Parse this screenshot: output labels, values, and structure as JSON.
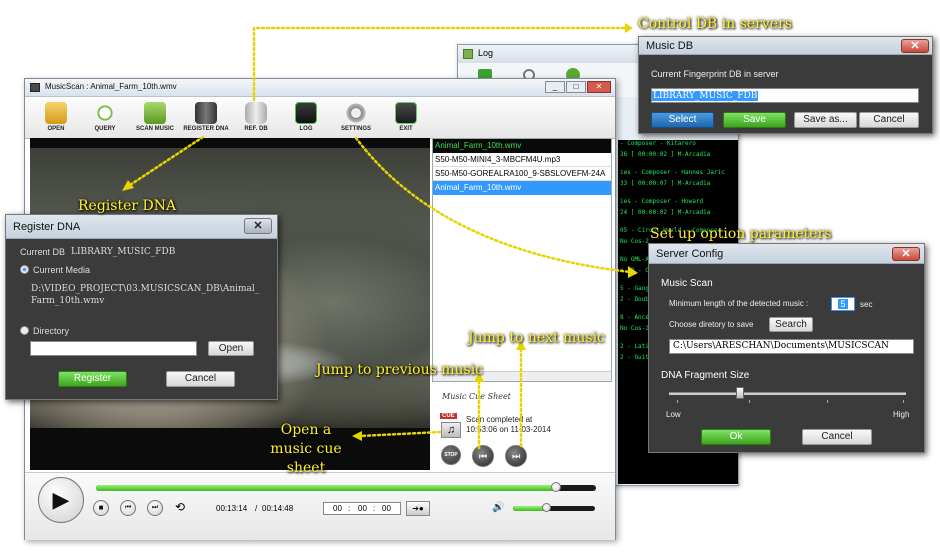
{
  "callouts": {
    "control_db": "Control DB in servers",
    "register_dna": "Register DNA",
    "setup_options": "Set up option parameters",
    "jump_next": "Jump to next music",
    "jump_prev": "Jump to previous music",
    "open_cue": "Open a music cue sheet"
  },
  "log_window": {
    "title": "Log",
    "lines": [
      "- Composer - Kitarero",
      "36 [ 00:00:02 ] M-Arcadia",
      "ies - Composer - Hannes Jaric",
      "33 [ 00:00:07 ] M-Arcadia",
      "ies - Composer - Howard",
      "24 [ 00:00:02 ] M-Arcadia",
      "05 - Circus World - Composer",
      "No Cos-2",
      "No GML-A1",
      "x 22 - Cor",
      "5 - Gang",
      "2 - Doub",
      "8 - Ancé",
      "No Cos-2",
      "2 - Lati",
      "2 - Guitar Sky - Composer -"
    ]
  },
  "main_window": {
    "title": "MusicScan : Animal_Farm_10th.wmv",
    "toolbar": [
      "OPEN",
      "QUERY",
      "SCAN MUSIC",
      "REGISTER DNA",
      "REF. DB",
      "LOG",
      "SETTINGS",
      "EXIT"
    ],
    "playlist": [
      "Animal_Farm_10th.wmv",
      "S50-M50-MINI4_3-MBCFM4U.mp3",
      "S50-M50-GOREALRA100_9-SBSLOVEFM-24A",
      "Animal_Farm_10th.wmv"
    ],
    "cue_sheet_label": "Music Cue Sheet",
    "cue_badge": "CUE",
    "status_line1": "Scan completed at",
    "status_line2": "10:53:06 on 11-03-2014",
    "stop_label": "STOP",
    "time_current": "00:13:14",
    "time_sep": "/",
    "time_total": "00:14:48",
    "seek_h": "00",
    "seek_m": "00",
    "seek_s": "00",
    "progress_pct": 92,
    "volume_pct": 40
  },
  "register_dna": {
    "title": "Register DNA",
    "current_db_label": "Current DB",
    "current_db_value": "LIBRARY_MUSIC_FDB",
    "current_media_label": "Current Media",
    "media_path": "D:\\VIDEO_PROJECT\\03.MUSICSCAN_DB\\Animal_Farm_10th.wmv",
    "directory_label": "Directory",
    "directory_value": "",
    "open_label": "Open",
    "register_label": "Register",
    "cancel_label": "Cancel"
  },
  "music_db": {
    "title": "Music DB",
    "label": "Current Fingerprint DB in server",
    "value": "LIBRARY_MUSIC_FDB",
    "select_label": "Select",
    "save_label": "Save",
    "save_as_label": "Save as...",
    "cancel_label": "Cancel"
  },
  "server_config": {
    "title": "Server Config",
    "section_music_scan": "Music Scan",
    "min_length_label": "Minimum length of the detected music :",
    "min_length_value": "5",
    "sec_label": "sec",
    "choose_dir_label": "Choose diretory to save",
    "search_label": "Search",
    "dir_value": "C:\\Users\\ARESCHAN\\Documents\\MUSICSCAN",
    "section_dna": "DNA Fragment Size",
    "low_label": "Low",
    "high_label": "High",
    "slider_level": 0.3,
    "ok_label": "Ok",
    "cancel_label": "Cancel"
  }
}
